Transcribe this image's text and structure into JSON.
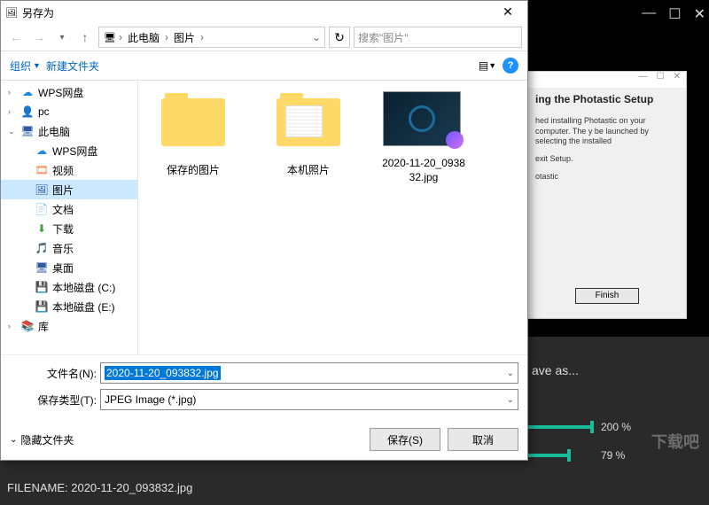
{
  "bg": {
    "minimize": "—",
    "maximize": "☐",
    "close": "✕",
    "save_as_text": "ave as...",
    "slider1_value": "200 %",
    "slider2_value": "79 %",
    "filename_label": "FILENAME: 2020-11-20_093832.jpg",
    "watermark": "下载吧"
  },
  "setup": {
    "heading": "ing the Photastic Setup",
    "text1": "hed installing Photastic on your computer. The y be launched by selecting the installed",
    "text2": "exit Setup.",
    "text3": "otastic",
    "finish": "Finish"
  },
  "dialog": {
    "title": "另存为",
    "close": "✕",
    "breadcrumb": {
      "pc": "此电脑",
      "pictures": "图片"
    },
    "search_placeholder": "搜索\"图片\"",
    "toolbar": {
      "organize": "组织",
      "new_folder": "新建文件夹"
    },
    "tree": [
      {
        "icon": "cloud",
        "label": "WPS网盘",
        "color": "#1e88e5"
      },
      {
        "icon": "person",
        "label": "pc",
        "color": "#3a7a3a"
      },
      {
        "icon": "monitor",
        "label": "此电脑",
        "color": "#2c5aa0",
        "expanded": true
      },
      {
        "icon": "cloud",
        "label": "WPS网盘",
        "child": true,
        "color": "#1e88e5"
      },
      {
        "icon": "film",
        "label": "视频",
        "child": true,
        "color": "#ff7b3a"
      },
      {
        "icon": "picture",
        "label": "图片",
        "child": true,
        "selected": true,
        "color": "#2c5aa0"
      },
      {
        "icon": "doc",
        "label": "文档",
        "child": true,
        "color": "#ff9a3a"
      },
      {
        "icon": "download",
        "label": "下载",
        "child": true,
        "color": "#3aa03a"
      },
      {
        "icon": "music",
        "label": "音乐",
        "child": true,
        "color": "#ff9a3a"
      },
      {
        "icon": "desktop",
        "label": "桌面",
        "child": true,
        "color": "#2c5aa0"
      },
      {
        "icon": "drive",
        "label": "本地磁盘 (C:)",
        "child": true,
        "color": "#888"
      },
      {
        "icon": "drive",
        "label": "本地磁盘 (E:)",
        "child": true,
        "color": "#888"
      },
      {
        "icon": "library",
        "label": "库",
        "color": "#4a7aa0"
      }
    ],
    "files": [
      {
        "type": "folder",
        "label": "保存的图片"
      },
      {
        "type": "folder-dec",
        "label": "本机照片"
      },
      {
        "type": "image",
        "label": "2020-11-20_093832.jpg"
      }
    ],
    "filename_label": "文件名(N):",
    "filename_value": "2020-11-20_093832.jpg",
    "filetype_label": "保存类型(T):",
    "filetype_value": "JPEG Image (*.jpg)",
    "hide_folders": "隐藏文件夹",
    "save_btn": "保存(S)",
    "cancel_btn": "取消"
  }
}
